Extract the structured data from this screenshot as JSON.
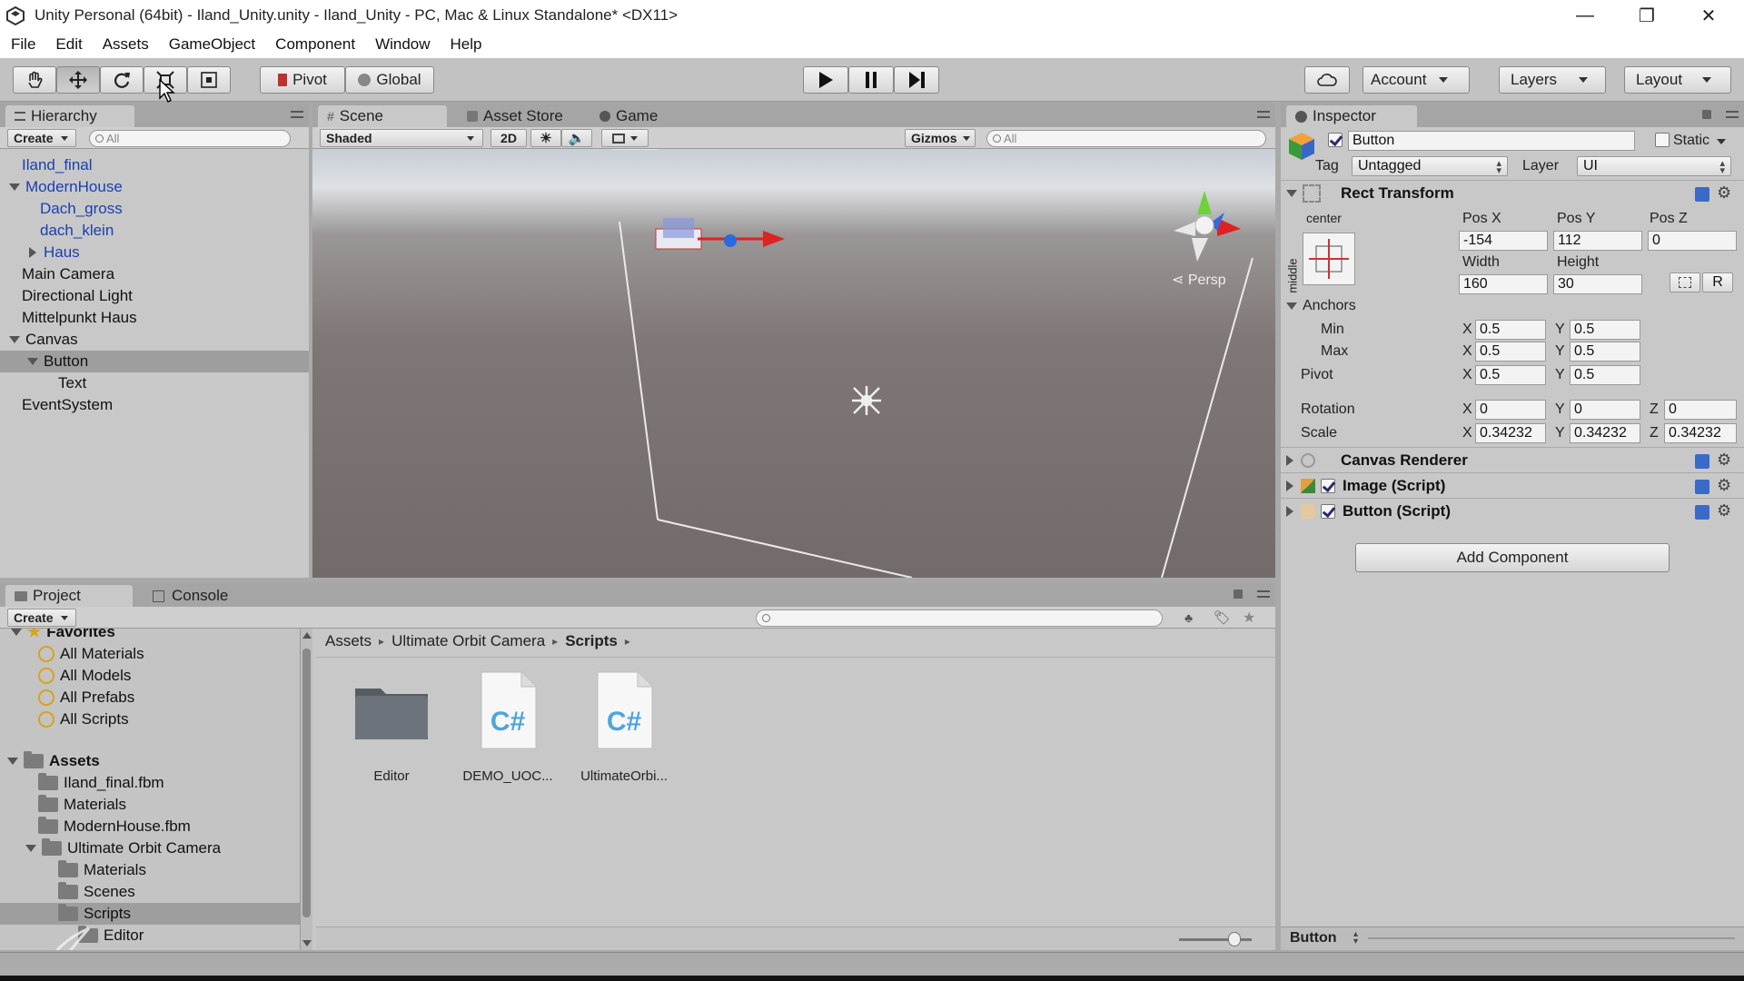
{
  "window": {
    "title": "Unity Personal (64bit) - Iland_Unity.unity - Iland_Unity - PC, Mac & Linux Standalone* <DX11>",
    "minimize": "—",
    "restore": "❐",
    "close": "✕"
  },
  "menu": [
    "File",
    "Edit",
    "Assets",
    "GameObject",
    "Component",
    "Window",
    "Help"
  ],
  "toolbar": {
    "pivot": "Pivot",
    "global": "Global",
    "account": "Account",
    "layers": "Layers",
    "layout": "Layout"
  },
  "hierarchy": {
    "tab": "Hierarchy",
    "create": "Create",
    "search_placeholder": "All",
    "items": [
      {
        "label": "Iland_final",
        "indent": 0,
        "blue": true,
        "arrow": ""
      },
      {
        "label": "ModernHouse",
        "indent": 0,
        "blue": true,
        "arrow": "down"
      },
      {
        "label": "Dach_gross",
        "indent": 1,
        "blue": true,
        "arrow": ""
      },
      {
        "label": "dach_klein",
        "indent": 1,
        "blue": true,
        "arrow": ""
      },
      {
        "label": "Haus",
        "indent": 1,
        "blue": true,
        "arrow": "right"
      },
      {
        "label": "Main Camera",
        "indent": 0,
        "blue": false,
        "arrow": ""
      },
      {
        "label": "Directional Light",
        "indent": 0,
        "blue": false,
        "arrow": ""
      },
      {
        "label": "Mittelpunkt Haus",
        "indent": 0,
        "blue": false,
        "arrow": ""
      },
      {
        "label": "Canvas",
        "indent": 0,
        "blue": false,
        "arrow": "down"
      },
      {
        "label": "Button",
        "indent": 1,
        "blue": false,
        "arrow": "down",
        "selected": true
      },
      {
        "label": "Text",
        "indent": 2,
        "blue": false,
        "arrow": ""
      },
      {
        "label": "EventSystem",
        "indent": 0,
        "blue": false,
        "arrow": ""
      }
    ]
  },
  "scene": {
    "tabs": [
      "Scene",
      "Asset Store",
      "Game"
    ],
    "shaded": "Shaded",
    "mode_2d": "2D",
    "gizmos": "Gizmos",
    "search_placeholder": "All",
    "persp": "Persp"
  },
  "project": {
    "tabs": [
      "Project",
      "Console"
    ],
    "create": "Create",
    "favorites_label": "Favorites",
    "favorites": [
      "All Materials",
      "All Models",
      "All Prefabs",
      "All Scripts"
    ],
    "assets_label": "Assets",
    "tree": [
      {
        "label": "Iland_final.fbm",
        "indent": 1,
        "arrow": ""
      },
      {
        "label": "Materials",
        "indent": 1,
        "arrow": ""
      },
      {
        "label": "ModernHouse.fbm",
        "indent": 1,
        "arrow": ""
      },
      {
        "label": "Ultimate Orbit Camera",
        "indent": 1,
        "arrow": "down"
      },
      {
        "label": "Materials",
        "indent": 2,
        "arrow": ""
      },
      {
        "label": "Scenes",
        "indent": 2,
        "arrow": ""
      },
      {
        "label": "Scripts",
        "indent": 2,
        "arrow": "",
        "selected": true
      },
      {
        "label": "Editor",
        "indent": 3,
        "arrow": ""
      }
    ],
    "breadcrumb": [
      "Assets",
      "Ultimate Orbit Camera",
      "Scripts"
    ],
    "assets": [
      {
        "label": "Editor",
        "kind": "folder"
      },
      {
        "label": "DEMO_UOC...",
        "kind": "script"
      },
      {
        "label": "UltimateOrbi...",
        "kind": "script"
      }
    ],
    "script_glyph": "C#"
  },
  "inspector": {
    "tab": "Inspector",
    "object_name": "Button",
    "static_label": "Static",
    "tag_label": "Tag",
    "tag_value": "Untagged",
    "layer_label": "Layer",
    "layer_value": "UI",
    "rect_transform": {
      "title": "Rect Transform",
      "anchor_h": "center",
      "anchor_v": "middle",
      "pos_x_label": "Pos X",
      "pos_y_label": "Pos Y",
      "pos_z_label": "Pos Z",
      "pos_x": "-154",
      "pos_y": "112",
      "pos_z": "0",
      "width_label": "Width",
      "height_label": "Height",
      "width": "160",
      "height": "30",
      "r_button": "R",
      "anchors_label": "Anchors",
      "min_label": "Min",
      "max_label": "Max",
      "pivot_label": "Pivot",
      "anchor_min_x": "0.5",
      "anchor_min_y": "0.5",
      "anchor_max_x": "0.5",
      "anchor_max_y": "0.5",
      "pivot_x": "0.5",
      "pivot_y": "0.5",
      "rotation_label": "Rotation",
      "rot_x": "0",
      "rot_y": "0",
      "rot_z": "0",
      "scale_label": "Scale",
      "scale_x": "0.34232",
      "scale_y": "0.34232",
      "scale_z": "0.34232",
      "x": "X",
      "y": "Y",
      "z": "Z"
    },
    "components": [
      "Canvas Renderer",
      "Image (Script)",
      "Button (Script)"
    ],
    "add_component": "Add Component",
    "footer_label": "Button"
  }
}
